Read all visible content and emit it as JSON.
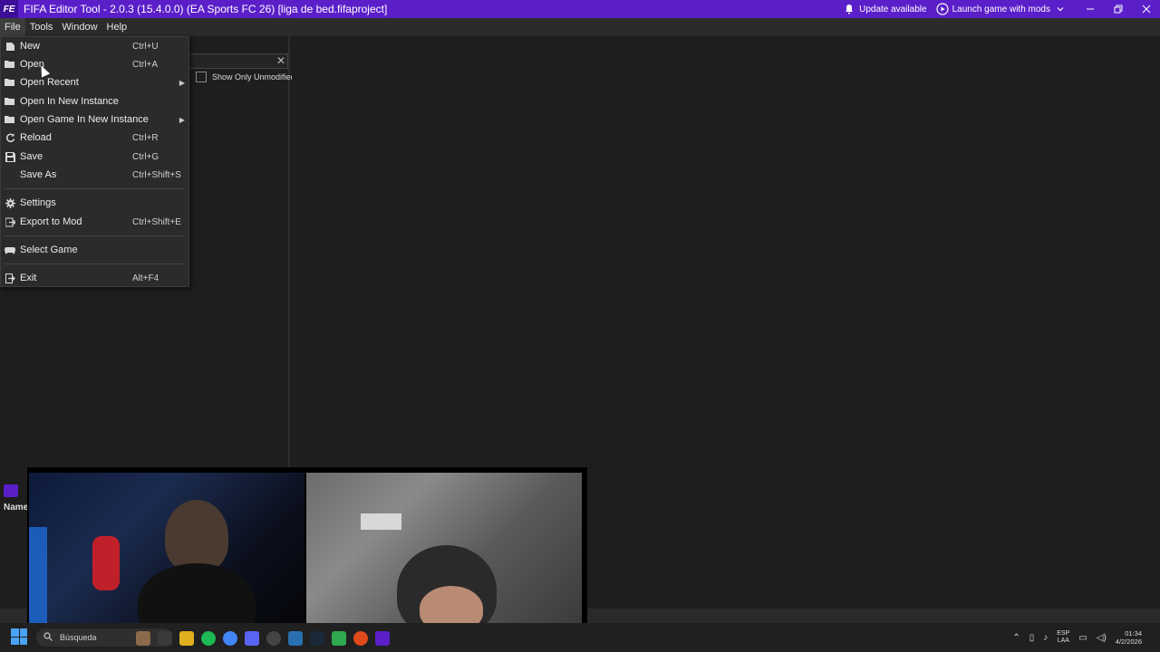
{
  "window": {
    "logo": "FE",
    "title": "FIFA Editor Tool - 2.0.3 (15.4.0.0) (EA Sports FC 26) [liga de bed.fifaproject]",
    "update_label": "Update available",
    "launch_label": "Launch game with mods",
    "accent": "#5b1fc9"
  },
  "menubar": {
    "items": [
      "File",
      "Tools",
      "Window",
      "Help"
    ]
  },
  "file_menu": {
    "items": [
      {
        "label": "New",
        "shortcut": "Ctrl+U",
        "icon": "new-icon"
      },
      {
        "label": "Open",
        "shortcut": "Ctrl+A",
        "icon": "folder-open-icon"
      },
      {
        "label": "Open Recent",
        "shortcut": "",
        "icon": "folder-open-icon",
        "submenu": true
      },
      {
        "label": "Open In New Instance",
        "shortcut": "",
        "icon": "folder-open-icon"
      },
      {
        "label": "Open Game In New Instance",
        "shortcut": "",
        "icon": "folder-open-icon",
        "submenu": true
      },
      {
        "label": "Reload",
        "shortcut": "Ctrl+R",
        "icon": "reload-icon"
      },
      {
        "label": "Save",
        "shortcut": "Ctrl+G",
        "icon": "save-icon"
      },
      {
        "label": "Save As",
        "shortcut": "Ctrl+Shift+S",
        "icon": "save-icon"
      },
      {
        "label": "Settings",
        "shortcut": "",
        "icon": "gear-icon"
      },
      {
        "label": "Export to Mod",
        "shortcut": "Ctrl+Shift+E",
        "icon": "export-icon"
      },
      {
        "label": "Select Game",
        "shortcut": "",
        "icon": "gamepad-icon"
      },
      {
        "label": "Exit",
        "shortcut": "Alt+F4",
        "icon": "exit-icon"
      }
    ]
  },
  "browser": {
    "show_only_unmodified": "Show Only Unmodified",
    "name_column": "Name"
  },
  "taskbar": {
    "search_placeholder": "Búsqueda",
    "lang_line1": "ESP",
    "lang_line2": "LAA",
    "time": "01:34",
    "date": "4/2/2026"
  }
}
